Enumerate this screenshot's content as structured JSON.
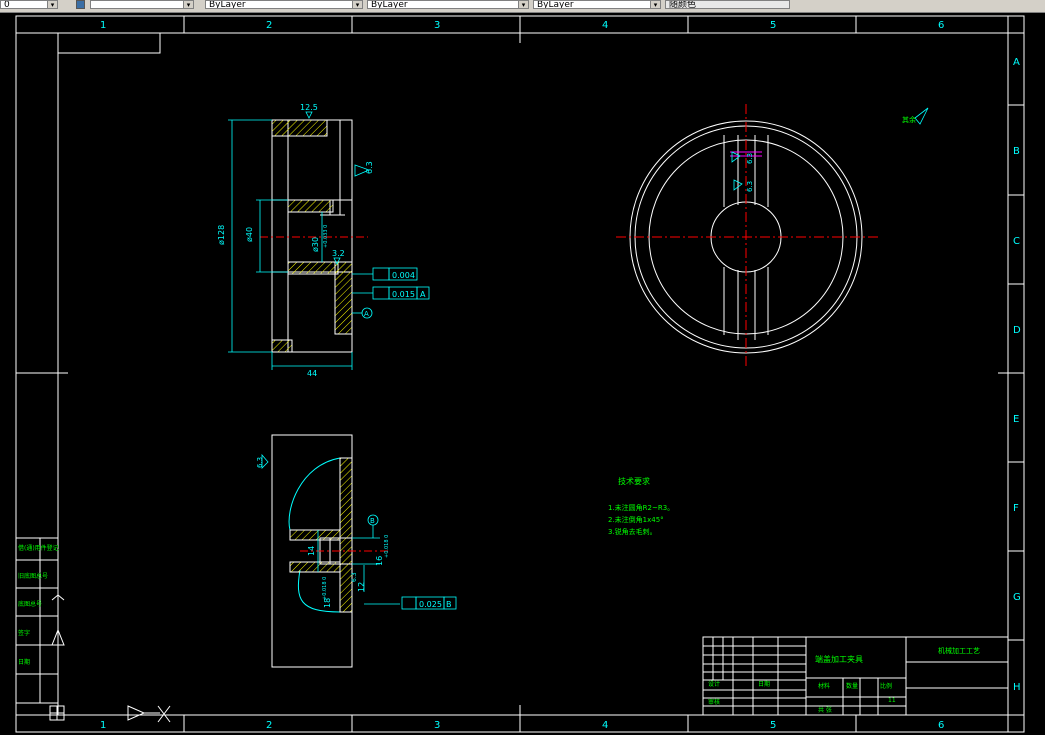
{
  "toolbar": {
    "layer_combo": "0",
    "color_combo": "ByLayer",
    "linetype_combo": "ByLayer",
    "lineweight_combo": "ByLayer",
    "plotstyle_combo": "随颜色"
  },
  "frame": {
    "columns": [
      "1",
      "2",
      "3",
      "4",
      "5",
      "6"
    ],
    "rows": [
      "A",
      "B",
      "C",
      "D",
      "E",
      "F",
      "G",
      "H"
    ]
  },
  "drawing": {
    "dims": {
      "dia128": "ø128",
      "dia40": "ø40",
      "dia30": "ø30",
      "tol30": "+0.033 0",
      "len44": "44",
      "rough125": "12.5",
      "rough63a": "6.3",
      "rough32": "3.2",
      "rough63b": "6.3",
      "rough63c": "6.3",
      "rough63d": "6.3",
      "rough63e": "6.3",
      "tol_flat": "0.004",
      "tol_perp": "0.015",
      "datum_a_ref": "A",
      "datum_a": "A",
      "datum_b": "B",
      "dim14": "14",
      "dim16": "16",
      "tol16": "+0.018 0",
      "dim18": "18",
      "tol18": "+0.018 0",
      "dim12": "12",
      "tol_par": "0.025",
      "datum_b_ref": "B",
      "rest_rough": "其余"
    },
    "tech_req": {
      "title": "技术要求",
      "line1": "1.未注圆角R2~R3。",
      "line2": "2.未注倒角1x45°",
      "line3": "3.锐角去毛刺。"
    },
    "title_block": {
      "part_name": "端盖加工夹具",
      "school": "机械加工工艺",
      "scale_label": "比例",
      "sheet_label": "共 张",
      "qty_label": "数量",
      "mat_label": "材料",
      "design_label": "设计",
      "check_label": "审核",
      "date_label": "日期",
      "count": "11"
    },
    "left_block": {
      "labels": [
        "借(通)用件登记",
        "旧底图总号",
        "底图总号",
        "签字",
        "日期"
      ]
    }
  }
}
